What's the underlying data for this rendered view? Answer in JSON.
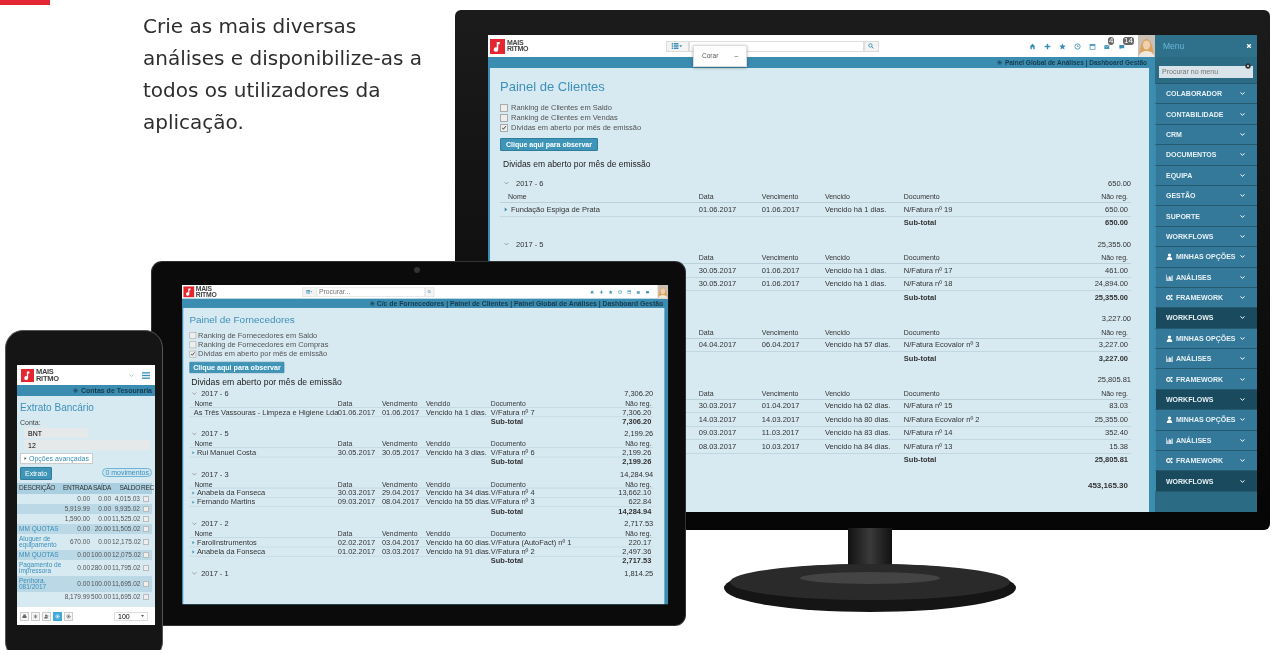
{
  "headline": "Crie as mais diversas análises e disponibilize-as a todos os utilizadores da aplicação.",
  "monitor": {
    "logo": "MAIS RITMO",
    "search_popup": [
      "Corar",
      "–"
    ],
    "tools": [
      {
        "kind": "home"
      },
      {
        "kind": "plus"
      },
      {
        "kind": "star"
      },
      {
        "kind": "clock"
      },
      {
        "kind": "calendar"
      },
      {
        "kind": "mail",
        "badge": "4"
      },
      {
        "kind": "chat",
        "badge": "14"
      }
    ],
    "breadcrumb": "Painel Global de Análises | Dashboard Gestão",
    "title": "Painel de Clientes",
    "options": [
      {
        "label": "Ranking de Clientes em Saldo",
        "checked": false
      },
      {
        "label": "Ranking de Clientes em Vendas",
        "checked": false
      },
      {
        "label": "Dividas em aberto por mês de emissão",
        "checked": true
      }
    ],
    "button": "Clique aqui para observar",
    "heading": "Dividas em aberto por mês de emissão",
    "groups": [
      {
        "label": "2017 - 6",
        "total": "650.00",
        "columns": {
          "name": "Nome",
          "date": "Data",
          "due": "Vencimento",
          "overdue": "Vencido",
          "document": "Documento",
          "amount": "Não reg."
        },
        "rows": [
          {
            "name": "Fundação Espiga de Prata",
            "date": "01.06.2017",
            "due": "01.06.2017",
            "overdue": "Vencido há 1 dias.",
            "document": "N/Fatura nº 19",
            "amount": "650.00"
          }
        ],
        "sub_label": "Sub-total",
        "subtotal": "650.00"
      },
      {
        "label": "2017 - 5",
        "total": "25,355.00",
        "columns": {
          "date": "Data",
          "due": "Vencimento",
          "overdue": "Vencido",
          "document": "Documento",
          "amount": "Não reg."
        },
        "rows": [
          {
            "date": "30.05.2017",
            "due": "01.06.2017",
            "overdue": "Vencido há 1 dias.",
            "document": "N/Fatura nº 17",
            "amount": "461.00"
          },
          {
            "date": "30.05.2017",
            "due": "01.06.2017",
            "overdue": "Vencido há 1 dias.",
            "document": "N/Fatura nº 18",
            "amount": "24,894.00"
          }
        ],
        "sub_label": "Sub-total",
        "subtotal": "25,355.00"
      },
      {
        "total": "3,227.00",
        "columns": {
          "date": "Data",
          "due": "Vencimento",
          "overdue": "Vencido",
          "document": "Documento",
          "amount": "Não reg."
        },
        "rows": [
          {
            "date": "04.04.2017",
            "due": "06.04.2017",
            "overdue": "Vencido há 57 dias.",
            "document": "N/Fatura Ecovalor nº 3",
            "amount": "3,227.00"
          }
        ],
        "sub_label": "Sub-total",
        "subtotal": "3,227.00"
      },
      {
        "total": "25,805.81",
        "columns": {
          "date": "Data",
          "due": "Vencimento",
          "overdue": "Vencido",
          "document": "Documento",
          "amount": "Não reg."
        },
        "rows": [
          {
            "date": "30.03.2017",
            "due": "01.04.2017",
            "overdue": "Vencido há 62 dias.",
            "document": "N/Fatura nº 15",
            "amount": "83.03"
          },
          {
            "date": "14.03.2017",
            "due": "14.03.2017",
            "overdue": "Vencido há 80 dias.",
            "document": "N/Fatura Ecovalor nº 2",
            "amount": "25,355.00"
          },
          {
            "date": "09.03.2017",
            "due": "11.03.2017",
            "overdue": "Vencido há 83 dias.",
            "document": "N/Fatura nº 14",
            "amount": "352.40"
          },
          {
            "date": "08.03.2017",
            "due": "10.03.2017",
            "overdue": "Vencido há 84 dias.",
            "document": "N/Fatura nº 13",
            "amount": "15.38"
          }
        ],
        "sub_label": "Sub-total",
        "subtotal": "25,805.81"
      }
    ],
    "grand_total": "453,165.30",
    "menu": {
      "title": "Menu",
      "search_placeholder": "Procurar no menu",
      "items": [
        {
          "label": "COLABORADOR",
          "kind": "plain",
          "shaded": false
        },
        {
          "label": "CONTABILIDADE",
          "kind": "plain",
          "shaded": false
        },
        {
          "label": "CRM",
          "kind": "plain",
          "shaded": false
        },
        {
          "label": "DOCUMENTOS",
          "kind": "plain",
          "shaded": false
        },
        {
          "label": "EQUIPA",
          "kind": "plain",
          "shaded": false
        },
        {
          "label": "GESTÃO",
          "kind": "plain",
          "shaded": false
        },
        {
          "label": "SUPORTE",
          "kind": "plain",
          "shaded": false
        },
        {
          "label": "WORKFLOWS",
          "kind": "plain",
          "shaded": false
        },
        {
          "label": "MINHAS OPÇÕES",
          "kind": "user",
          "shaded": false
        },
        {
          "label": "ANÁLISES",
          "kind": "chart",
          "shaded": false
        },
        {
          "label": "FRAMEWORK",
          "kind": "gears",
          "shaded": false
        },
        {
          "label": "WORKFLOWS",
          "kind": "plain",
          "shaded": true
        },
        {
          "label": "MINHAS OPÇÕES",
          "kind": "user",
          "shaded": false
        },
        {
          "label": "ANÁLISES",
          "kind": "chart",
          "shaded": false
        },
        {
          "label": "FRAMEWORK",
          "kind": "gears",
          "shaded": false
        },
        {
          "label": "WORKFLOWS",
          "kind": "plain",
          "shaded": true
        },
        {
          "label": "MINHAS OPÇÕES",
          "kind": "user",
          "shaded": false
        },
        {
          "label": "ANÁLISES",
          "kind": "chart",
          "shaded": false
        },
        {
          "label": "FRAMEWORK",
          "kind": "gears",
          "shaded": false
        },
        {
          "label": "WORKFLOWS",
          "kind": "plain",
          "shaded": true
        }
      ]
    }
  },
  "tablet": {
    "logo": "MAIS RITMO",
    "search_placeholder": "Procurar...",
    "tools": [
      {
        "kind": "home"
      },
      {
        "kind": "plus"
      },
      {
        "kind": "star"
      },
      {
        "kind": "clock"
      },
      {
        "kind": "calendar"
      },
      {
        "kind": "mail"
      },
      {
        "kind": "chat"
      }
    ],
    "breadcrumb": "C/c de Fornecedores | Painel de Clientes | Painel Global de Análises | Dashboard Gestão",
    "title": "Painel de Fornecedores",
    "options": [
      {
        "label": "Ranking de Fornecedores em Saldo",
        "checked": false
      },
      {
        "label": "Ranking de Fornecedores em Compras",
        "checked": false
      },
      {
        "label": "Dividas em aberto por mês de emissão",
        "checked": true
      }
    ],
    "button": "Clique aqui para observar",
    "heading": "Dividas em aberto por mês de emissão",
    "groups": [
      {
        "label": "2017 - 6",
        "total": "7,306.20",
        "columns": {
          "name": "Nome",
          "date": "Data",
          "due": "Vencimento",
          "overdue": "Vencido",
          "document": "Documento",
          "amount": "Não reg."
        },
        "rows": [
          {
            "name": "As Três Vassouras - Limpeza e Higiene Lda",
            "date": "01.06.2017",
            "due": "01.06.2017",
            "overdue": "Vencido há 1 dias.",
            "document": "V/Fatura nº 7",
            "amount": "7,306.20"
          }
        ],
        "sub_label": "Sub-total",
        "subtotal": "7,306.20"
      },
      {
        "label": "2017 - 5",
        "total": "2,199.26",
        "columns": {
          "name": "Nome",
          "date": "Data",
          "due": "Vencimento",
          "overdue": "Vencido",
          "document": "Documento",
          "amount": "Não reg."
        },
        "rows": [
          {
            "name": "Rui Manuel Costa",
            "date": "30.05.2017",
            "due": "30.05.2017",
            "overdue": "Vencido há 3 dias.",
            "document": "V/Fatura nº 6",
            "amount": "2,199.26"
          }
        ],
        "sub_label": "Sub-total",
        "subtotal": "2,199.26"
      },
      {
        "label": "2017 - 3",
        "total": "14,284.94",
        "columns": {
          "name": "Nome",
          "date": "Data",
          "due": "Vencimento",
          "overdue": "Vencido",
          "document": "Documento",
          "amount": "Não reg."
        },
        "rows": [
          {
            "name": "Anabela da Fonseca",
            "date": "30.03.2017",
            "due": "29.04.2017",
            "overdue": "Vencido há 34 dias.",
            "document": "V/Fatura nº 4",
            "amount": "13,662.10"
          },
          {
            "name": "Fernando Martins",
            "date": "09.03.2017",
            "due": "08.04.2017",
            "overdue": "Vencido há 55 dias.",
            "document": "V/Fatura nº 3",
            "amount": "622.84"
          }
        ],
        "sub_label": "Sub-total",
        "subtotal": "14,284.94"
      },
      {
        "label": "2017 - 2",
        "total": "2,717.53",
        "columns": {
          "name": "Nome",
          "date": "Data",
          "due": "Vencimento",
          "overdue": "Vencido",
          "document": "Documento",
          "amount": "Não reg."
        },
        "rows": [
          {
            "name": "FarolInstrumentos",
            "date": "02.02.2017",
            "due": "03.04.2017",
            "overdue": "Vencido há 60 dias.",
            "document": "V/Fatura (AutoFact) nº 1",
            "amount": "220.17"
          },
          {
            "name": "Anabela da Fonseca",
            "date": "01.02.2017",
            "due": "03.03.2017",
            "overdue": "Vencido há 91 dias.",
            "document": "V/Fatura nº 2",
            "amount": "2,497.36"
          }
        ],
        "sub_label": "Sub-total",
        "subtotal": "2,717.53"
      },
      {
        "label": "2017 - 1",
        "total": "1,814.25"
      }
    ]
  },
  "phone": {
    "logo": "MAIS RITMO",
    "breadcrumb": "Contas de Tesouraria",
    "title": "Extrato Bancário",
    "account_label": "Conta:",
    "fields": [
      "BNT",
      "12"
    ],
    "advanced": "Opções avançadas",
    "button": "Extrato",
    "count": "0 movimentos",
    "columns": [
      "DESCRIÇÃO",
      "ENTRADA",
      "SAÍDA",
      "SALDO",
      "REC"
    ],
    "rows": [
      {
        "in": "0.00",
        "out": "0.00",
        "balance": "4,015.03",
        "checked": false
      },
      {
        "in": "5,919.99",
        "out": "0.00",
        "balance": "9,935.02",
        "checked": false
      },
      {
        "in": "1,590.00",
        "out": "0.00",
        "balance": "11,525.02",
        "checked": false
      },
      {
        "description": "MM QUOTAS",
        "in": "0.00",
        "out": "20.00",
        "balance": "11,505.02",
        "checked": false
      },
      {
        "description": "Aluguer de equipamento",
        "in": "670.00",
        "out": "0.00",
        "balance": "12,175.02",
        "checked": false
      },
      {
        "description": "MM QUOTAS",
        "in": "0.00",
        "out": "100.00",
        "balance": "12,075.02",
        "checked": false
      },
      {
        "description": "Pagamento de impressora",
        "in": "0.00",
        "out": "280.00",
        "balance": "11,795.02",
        "checked": false
      },
      {
        "description": "Penhora. 081/2017",
        "in": "0.00",
        "out": "100.00",
        "balance": "11,695.02",
        "checked": false
      },
      {
        "in": "8,179.99",
        "out": "500.00",
        "balance": "11,695.02",
        "checked": false
      }
    ],
    "footer_buttons": [
      {
        "kind": "printer",
        "selected": false
      },
      {
        "kind": "asterisk",
        "selected": false
      },
      {
        "kind": "users",
        "selected": false
      },
      {
        "kind": "gear",
        "selected": true
      },
      {
        "kind": "gear",
        "selected": false
      }
    ],
    "page_size": "100"
  }
}
